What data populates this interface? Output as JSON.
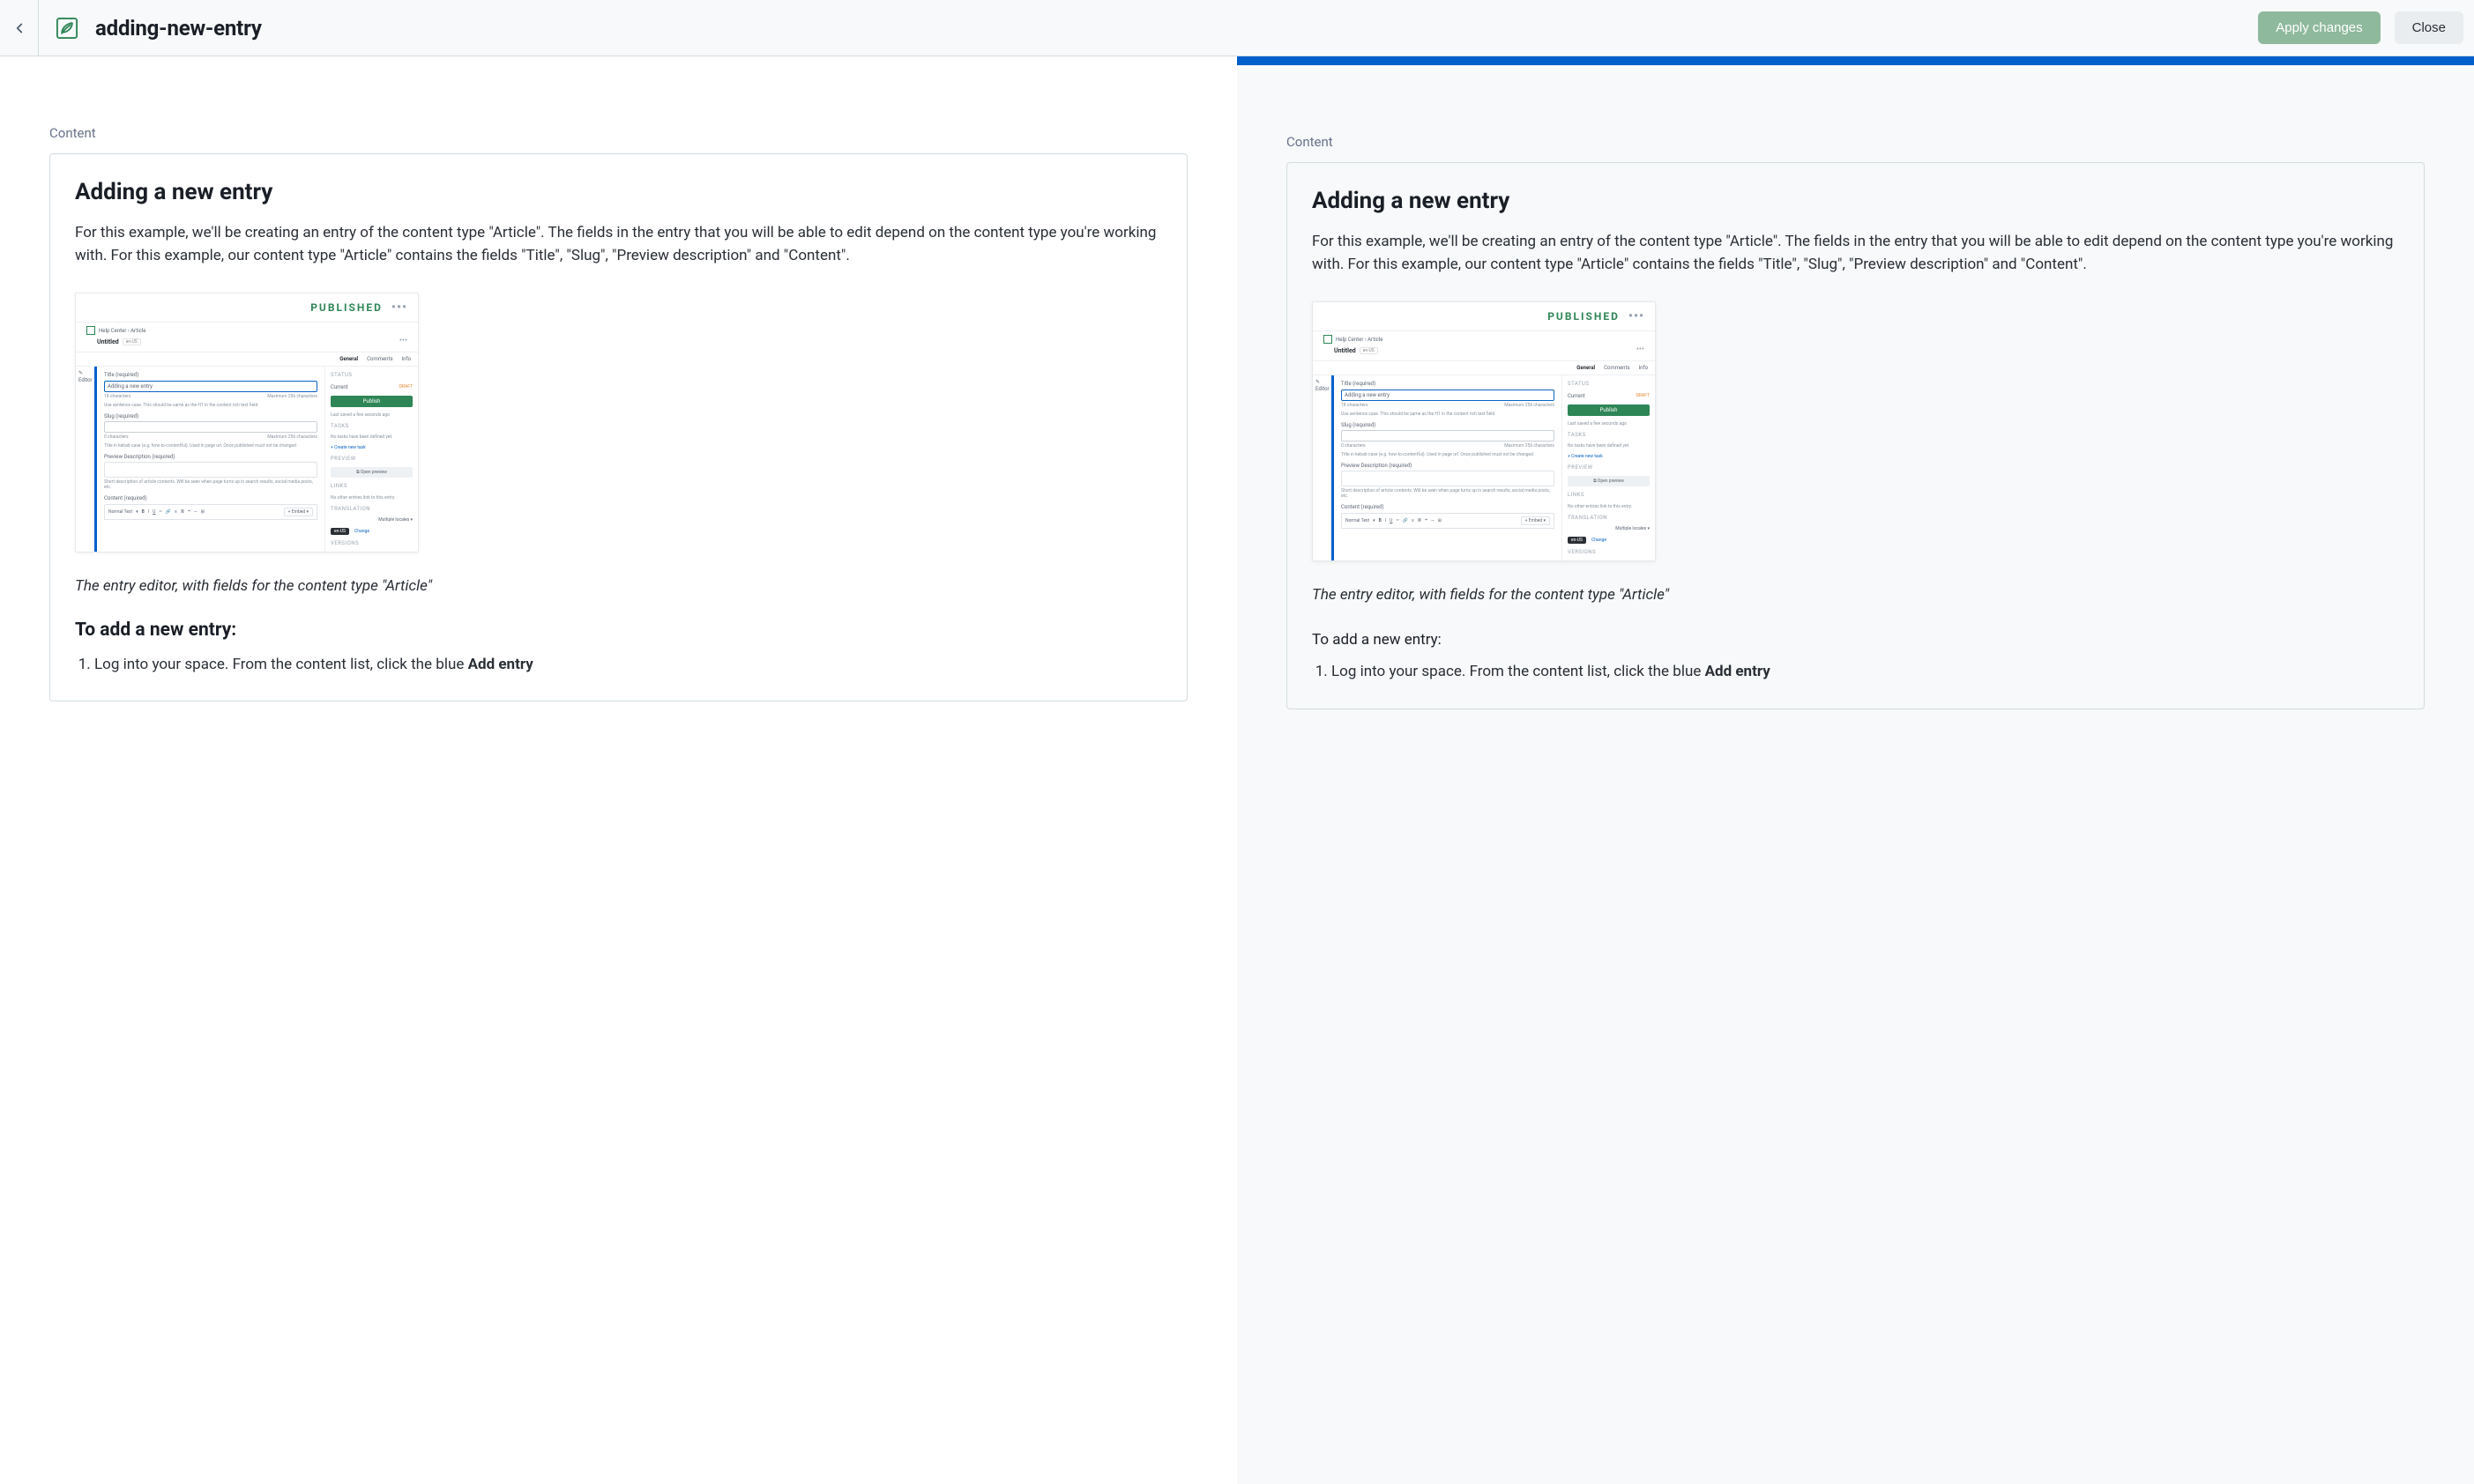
{
  "topbar": {
    "title": "adding-new-entry",
    "apply_label": "Apply changes",
    "close_label": "Close"
  },
  "pane_label": "Content",
  "article": {
    "heading": "Adding a new entry",
    "intro": "For this example, we'll be creating an entry of the content type \"Article\". The fields in the entry that you will be able to edit depend on the content type you're working with. For this example, our content type \"Article\" contains the fields \"Title\", \"Slug\", \"Preview description\" and \"Content\".",
    "caption": "The entry editor, with fields for the content type \"Article\"",
    "subheading": "To add a new entry:",
    "step1_pre": "Log into your space. From the content list, click the blue ",
    "step1_bold": "Add entry"
  },
  "screenshot": {
    "published": "PUBLISHED",
    "breadcrumb": "Help Center › Article",
    "doc_title": "Untitled",
    "lang_badge": "en-US",
    "editor_tab": "✎ Editor",
    "tabs": {
      "general": "General",
      "comments": "Comments",
      "info": "Info"
    },
    "title_field": {
      "label": "Title (required)",
      "value": "Adding a new entry",
      "count": "18 characters",
      "max": "Maximum 256 characters",
      "hint": "Use sentence case. This should be same as the H1 in the content rich text field"
    },
    "slug_field": {
      "label": "Slug (required)",
      "count": "0 characters",
      "max": "Maximum 256 characters",
      "hint": "Title in kebab case (e.g. how-to-contentful). Used in page url. Once published must not be changed"
    },
    "preview_field": {
      "label": "Preview Description (required)",
      "hint": "Short description of article contents. Will be seen when page turns up in search results, social media posts, etc."
    },
    "content_field": {
      "label": "Content (required)",
      "normal": "Normal Text",
      "embed": "+ Embed ▾"
    },
    "sidebar": {
      "status": "STATUS",
      "current": "Current",
      "draft": "DRAFT",
      "publish": "Publish",
      "saved": "Last saved a few seconds ago",
      "tasks": "TASKS",
      "no_tasks": "No tasks have been defined yet.",
      "create_task": "+ Create new task",
      "preview": "PREVIEW",
      "open_preview": "⧉ Open preview",
      "links": "LINKS",
      "no_links": "No other entries link to this entry.",
      "translation": "TRANSLATION",
      "multi": "Multiple locales ▾",
      "pill": "en-US",
      "change": "Change",
      "versions": "VERSIONS"
    }
  }
}
